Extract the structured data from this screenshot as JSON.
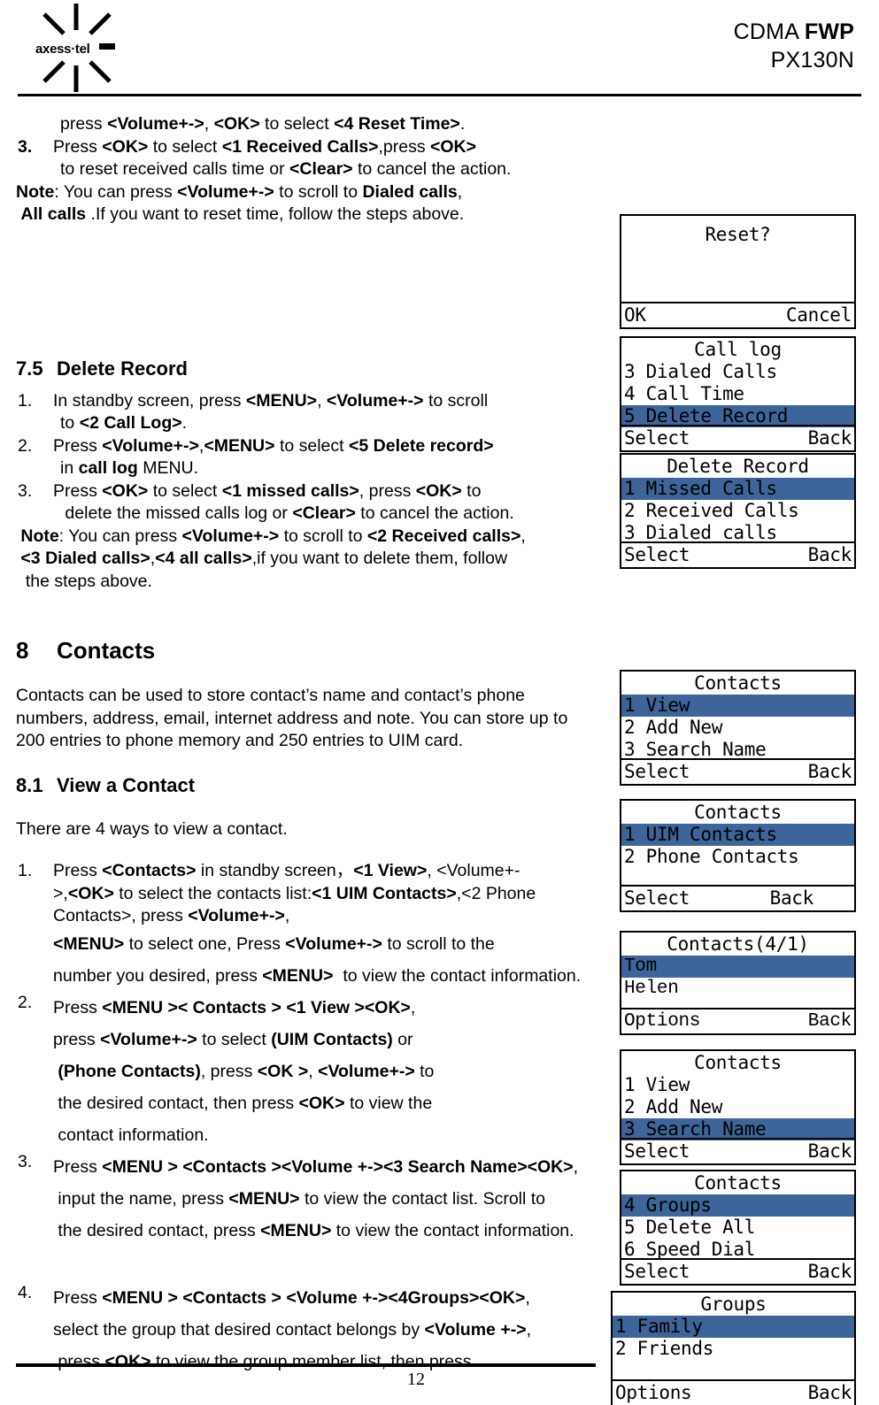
{
  "header": {
    "logo_text": "axess·tel",
    "title_line1_light": "CDMA ",
    "title_line1_bold": "FWP",
    "title_line2": "PX130N"
  },
  "body": {
    "intro": {
      "line_a": "press <Volume+->, <OK> to select <4 Reset Time>.",
      "item3_marker": "3.",
      "item3_line1": "Press <OK> to select <1 Received Calls>,press <OK>",
      "item3_line2": "to reset received calls time or <Clear> to cancel the action.",
      "note_line1": "Note: You can press <Volume+-> to scroll to Dialed calls,",
      "note_line2": " All calls .If you want to reset time, follow the steps above."
    },
    "section_7_5": {
      "number": "7.5",
      "title": "Delete Record",
      "items": [
        {
          "marker": "1.",
          "line1": "In standby screen, press <MENU>, <Volume+-> to scroll",
          "line2": "to <2 Call Log>."
        },
        {
          "marker": "2.",
          "line1": "Press <Volume+->,<MENU> to select <5 Delete record>",
          "line2": "in call log MENU."
        },
        {
          "marker": "3.",
          "line1": "Press <OK> to select <1 missed calls>, press <OK> to",
          "line2": " delete the missed calls log or <Clear> to cancel the action."
        }
      ],
      "note_line1": " Note: You can press <Volume+-> to scroll to <2 Received calls>,",
      "note_line2": " <3 Dialed calls>,<4 all calls>,if you want to delete them, follow",
      "note_line3": "  the steps above."
    },
    "section_8": {
      "number": "8",
      "title": "Contacts",
      "intro_line1": "Contacts can be used to store contact’s name and contact’s phone",
      "intro_line2": "numbers, address, email, internet address and note. You can store up to",
      "intro_line3": "200 entries to phone memory and 250 entries to UIM card."
    },
    "section_8_1": {
      "number": "8.1",
      "title": "View a Contact",
      "lead": "There are 4 ways to view a contact.",
      "items": [
        {
          "marker": "1.",
          "lines": [
            "Press <Contacts> in standby screen，<1 View>, <Volume+-",
            ">,<OK> to select the contacts list:<1 UIM Contacts>,<2 Phone",
            "Contacts>, press <Volume+->,",
            "<MENU> to select one, Press <Volume+-> to scroll to the",
            "number you desired, press <MENU>  to view the contact information."
          ]
        },
        {
          "marker": "2.",
          "lines": [
            "Press <MENU >< Contacts > <1 View ><OK>,",
            "press <Volume+-> to select (UIM Contacts) or",
            " (Phone Contacts), press <OK >, <Volume+-> to",
            " the desired contact, then press <OK> to view the",
            " contact information."
          ]
        },
        {
          "marker": "3.",
          "lines": [
            "Press <MENU > <Contacts ><Volume +-><3 Search Name><OK>,",
            " input the name, press <MENU> to view the contact list. Scroll to",
            " the desired contact, press <MENU> to view the contact information."
          ]
        },
        {
          "marker": "4.",
          "lines": [
            "Press <MENU > <Contacts > <Volume +-><4Groups><OK>,",
            "select the group that desired contact belongs by <Volume +->,",
            " press <OK> to view the group member list, then press"
          ]
        }
      ]
    }
  },
  "screens": [
    {
      "id": "reset-dialog",
      "title": "Reset?",
      "rows": [],
      "blanks": 2,
      "soft_left": "OK",
      "soft_right": "Cancel"
    },
    {
      "id": "call-log",
      "title": "Call log",
      "rows": [
        {
          "label": "3 Dialed Calls",
          "selected": false
        },
        {
          "label": "4 Call Time",
          "selected": false
        },
        {
          "label": "5 Delete Record",
          "selected": true
        }
      ],
      "soft_left": "Select",
      "soft_right": "Back"
    },
    {
      "id": "delete-record",
      "title": "Delete Record",
      "rows": [
        {
          "label": "1 Missed Calls",
          "selected": true
        },
        {
          "label": "2 Received Calls",
          "selected": false
        },
        {
          "label": "3 Dialed calls",
          "selected": false
        }
      ],
      "soft_left": "Select",
      "soft_right": "Back"
    },
    {
      "id": "contacts-main",
      "title": "Contacts",
      "rows": [
        {
          "label": "1 View",
          "selected": true
        },
        {
          "label": "2 Add New",
          "selected": false
        },
        {
          "label": "3 Search Name",
          "selected": false
        }
      ],
      "soft_left": "Select",
      "soft_right": "Back"
    },
    {
      "id": "contacts-source",
      "title": "Contacts",
      "rows": [
        {
          "label": "1 UIM Contacts",
          "selected": true
        },
        {
          "label": "2 Phone Contacts",
          "selected": false
        }
      ],
      "blanks": 1,
      "soft_left": "Select",
      "soft_right": "Back"
    },
    {
      "id": "contacts-list",
      "title": "Contacts(4/1)",
      "rows": [
        {
          "label": "Tom",
          "selected": true
        },
        {
          "label": "Helen",
          "selected": false
        }
      ],
      "soft_left": "Options",
      "soft_right": "Back"
    },
    {
      "id": "contacts-search",
      "title": "Contacts",
      "rows": [
        {
          "label": "1 View",
          "selected": false
        },
        {
          "label": "2 Add New",
          "selected": false
        },
        {
          "label": "3 Search Name",
          "selected": true
        }
      ],
      "soft_left": "Select",
      "soft_right": "Back"
    },
    {
      "id": "contacts-more",
      "title": "Contacts",
      "rows": [
        {
          "label": "4 Groups",
          "selected": true
        },
        {
          "label": "5 Delete All",
          "selected": false
        },
        {
          "label": "6 Speed Dial",
          "selected": false
        }
      ],
      "soft_left": "Select",
      "soft_right": "Back"
    },
    {
      "id": "groups",
      "title": "Groups",
      "rows": [
        {
          "label": "1 Family",
          "selected": true
        },
        {
          "label": "2 Friends",
          "selected": false
        }
      ],
      "blanks": 1,
      "soft_left": "Options",
      "soft_right": "Back"
    }
  ],
  "footer": {
    "page_number": "12"
  },
  "colors": {
    "highlight": "#3d6599",
    "text": "#000000",
    "page_bg": "#ffffff"
  }
}
